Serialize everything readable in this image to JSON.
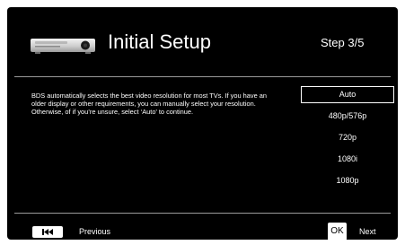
{
  "header": {
    "title": "Initial Setup",
    "step": "Step 3/5",
    "icon": "blu-ray-player-icon"
  },
  "description": "BDS automatically selects the best video resolution for most TVs. If you have an older display or other requirements, you can manually select your resolution. Otherwise, of if you’re unsure, select ‘Auto’ to continue.",
  "resolution_options": [
    {
      "label": "Auto",
      "selected": true
    },
    {
      "label": "480p/576p",
      "selected": false
    },
    {
      "label": "720p",
      "selected": false
    },
    {
      "label": "1080i",
      "selected": false
    },
    {
      "label": "1080p",
      "selected": false
    }
  ],
  "footer": {
    "previous_label": "Previous",
    "previous_icon": "skip-back-icon",
    "ok_label": "OK",
    "next_label": "Next"
  },
  "colors": {
    "background": "#000000",
    "text": "#ffffff",
    "divider": "#9a9a9a",
    "frame": "#ffffff"
  }
}
